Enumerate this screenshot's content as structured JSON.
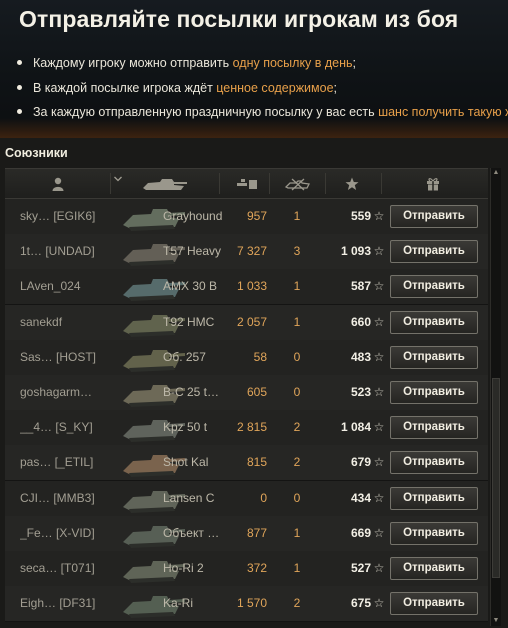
{
  "header": {
    "title": "Отправляйте посылки игрокам из боя",
    "bullets": [
      {
        "pre": "Каждому игроку можно отправить ",
        "hl": "одну посылку в день",
        "post": ";"
      },
      {
        "pre": "В каждой посылке игрока ждёт ",
        "hl": "ценное содержимое",
        "post": ";"
      },
      {
        "pre": "За каждую отправленную праздничную посылку у вас есть ",
        "hl": "шанс получить такую же",
        "post": ""
      }
    ]
  },
  "section": {
    "title": "Союзники"
  },
  "columns": [
    {
      "icon": "player-icon"
    },
    {
      "icon": "tank-icon"
    },
    {
      "icon": "damage-icon"
    },
    {
      "icon": "kills-icon"
    },
    {
      "icon": "star-icon"
    },
    {
      "icon": "gift-icon"
    }
  ],
  "rows": [
    {
      "player": "sky… [EGIK6]",
      "tank": "Grayhound",
      "damage": "957",
      "kills": "1",
      "xp": "559",
      "action": "Отправить"
    },
    {
      "player": "1t… [UNDAD]",
      "tank": "T57 Heavy",
      "damage": "7 327",
      "kills": "3",
      "xp": "1 093",
      "action": "Отправить"
    },
    {
      "player": "LAven_024",
      "tank": "AMX 30 B",
      "damage": "1 033",
      "kills": "1",
      "xp": "587",
      "action": "Отправить"
    },
    {
      "player": "sanekdf",
      "tank": "T92 HMC",
      "damage": "2 057",
      "kills": "1",
      "xp": "660",
      "action": "Отправить"
    },
    {
      "player": "Sas… [HOST]",
      "tank": "Об. 257",
      "damage": "58",
      "kills": "0",
      "xp": "483",
      "action": "Отправить"
    },
    {
      "player": "goshagarm…",
      "tank": "В-С 25 t…",
      "damage": "605",
      "kills": "0",
      "xp": "523",
      "action": "Отправить"
    },
    {
      "player": "__4… [S_KY]",
      "tank": "Kpz 50 t",
      "damage": "2 815",
      "kills": "2",
      "xp": "1 084",
      "action": "Отправить"
    },
    {
      "player": "pas… [_ETIL]",
      "tank": "Shot Kal",
      "damage": "815",
      "kills": "2",
      "xp": "679",
      "action": "Отправить"
    },
    {
      "player": "CJI… [MMB3]",
      "tank": "Lansen C",
      "damage": "0",
      "kills": "0",
      "xp": "434",
      "action": "Отправить"
    },
    {
      "player": "_Fe… [X-VID]",
      "tank": "Объект …",
      "damage": "877",
      "kills": "1",
      "xp": "669",
      "action": "Отправить"
    },
    {
      "player": "seca… [T071]",
      "tank": "Ho-Ri 2",
      "damage": "372",
      "kills": "1",
      "xp": "527",
      "action": "Отправить"
    },
    {
      "player": "Eigh… [DF31]",
      "tank": "Ka-Ri",
      "damage": "1 570",
      "kills": "2",
      "xp": "675",
      "action": "Отправить"
    }
  ],
  "colors": {
    "accent": "#e8a04a",
    "value": "#e0a55a"
  }
}
